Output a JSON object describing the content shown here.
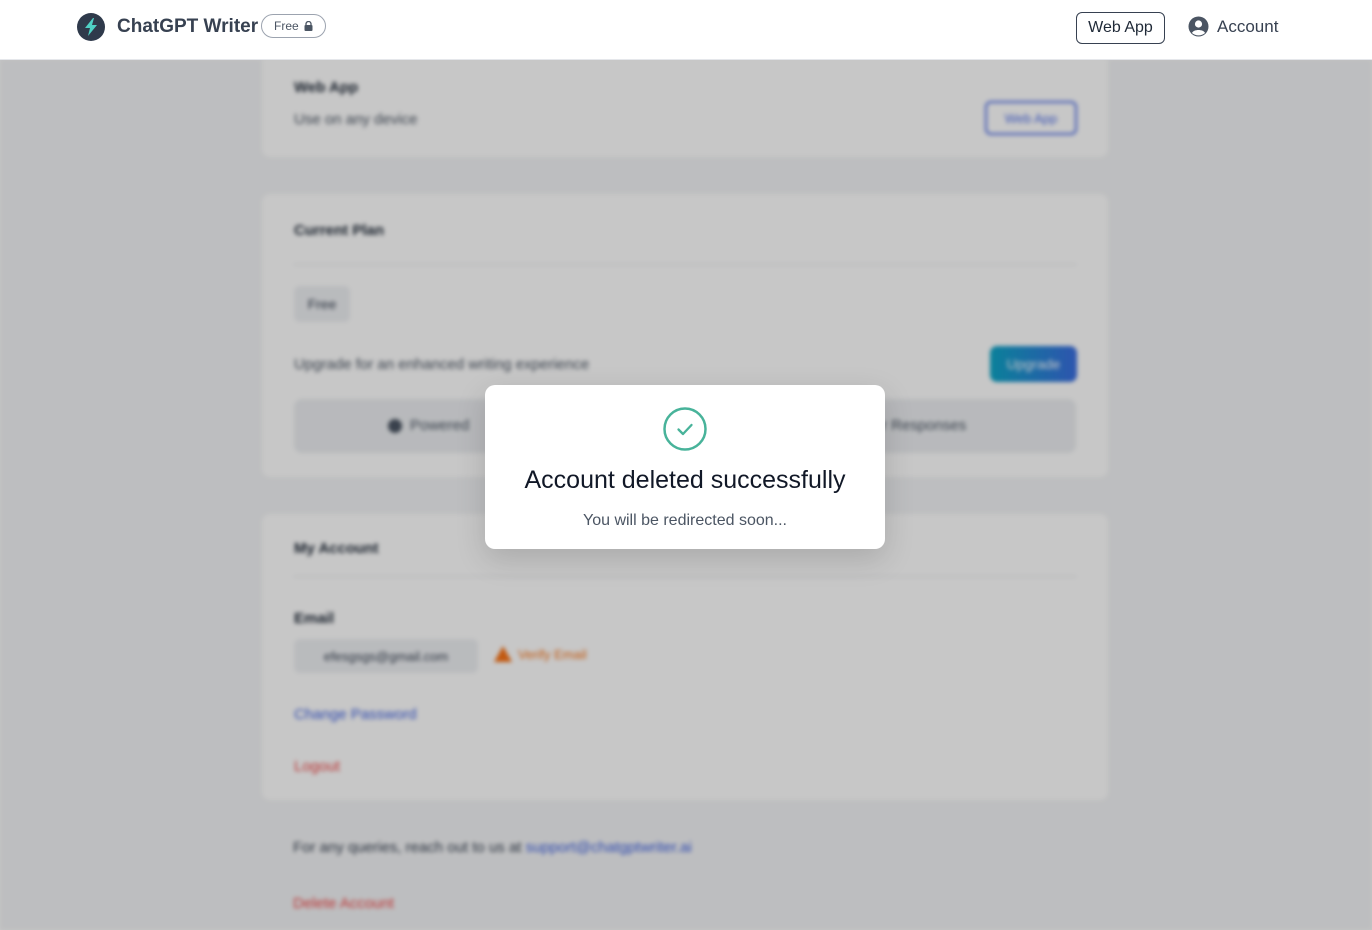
{
  "header": {
    "app_name": "ChatGPT Writer",
    "plan_badge": "Free",
    "web_app_button": "Web App",
    "account_label": "Account"
  },
  "web_app_section": {
    "title": "Web App",
    "description": "Use on any device",
    "button": "Web App"
  },
  "plan_section": {
    "title": "Current Plan",
    "plan": "Free",
    "upgrade_text": "Upgrade for an enhanced writing experience",
    "upgrade_button": "Upgrade",
    "powered_left": "Powered",
    "powered_right": "r Responses"
  },
  "account_section": {
    "title": "My Account",
    "email_label": "Email",
    "email_value": "efesgsgs@gmail.com",
    "verify_label": "Verify Email",
    "change_password": "Change Password",
    "logout": "Logout"
  },
  "footer": {
    "queries_text": "For any queries, reach out to us at",
    "support_email": "support@chatgptwriter.ai",
    "delete_account": "Delete Account"
  },
  "modal": {
    "title": "Account deleted successfully",
    "message": "You will be redirected soon...",
    "icon": "check-circle-icon"
  },
  "colors": {
    "success": "#48b39a",
    "accent_blue": "#3b5ee0",
    "danger": "#ef4444",
    "warning": "#f97316"
  }
}
